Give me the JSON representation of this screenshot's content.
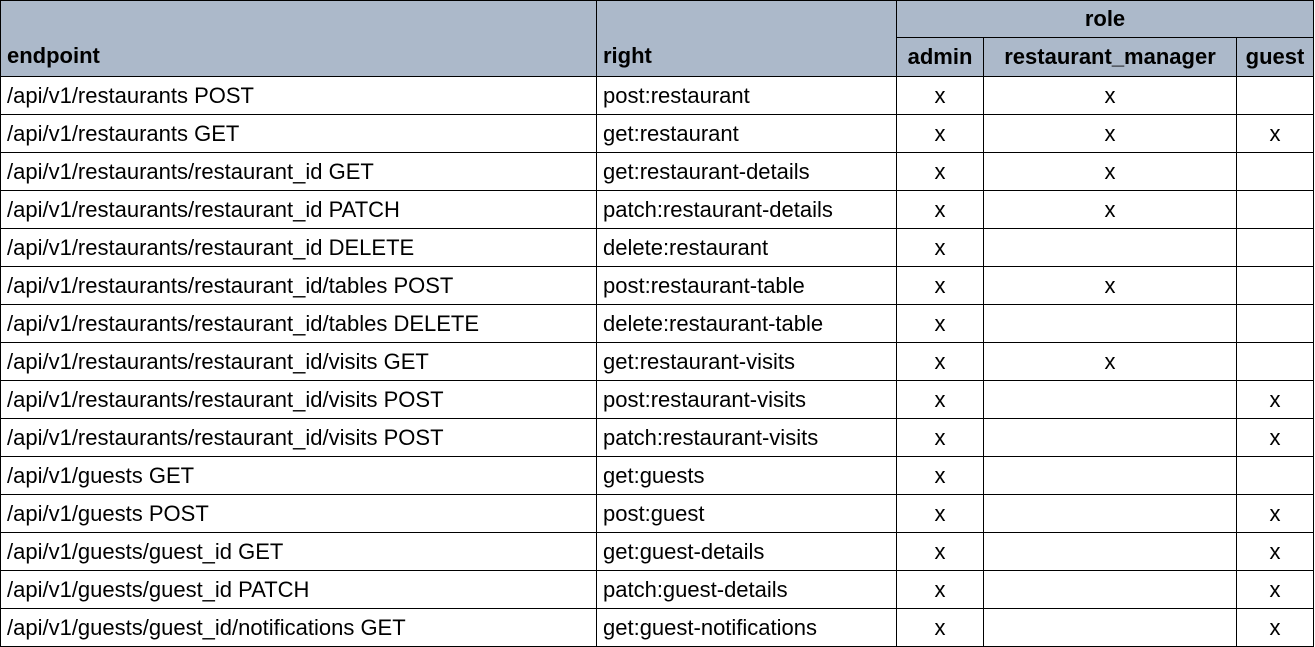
{
  "header": {
    "endpoint_label": "endpoint",
    "right_label": "right",
    "role_group_label": "role",
    "roles": [
      "admin",
      "restaurant_manager",
      "guest"
    ]
  },
  "mark_symbol": "x",
  "colors": {
    "header_bg": "#acb9ca",
    "grid": "#000000"
  },
  "rows": [
    {
      "endpoint": "/api/v1/restaurants POST",
      "right": "post:restaurant",
      "admin": "x",
      "restaurant_manager": "x",
      "guest": ""
    },
    {
      "endpoint": "/api/v1/restaurants GET",
      "right": "get:restaurant",
      "admin": "x",
      "restaurant_manager": "x",
      "guest": "x"
    },
    {
      "endpoint": "/api/v1/restaurants/restaurant_id GET",
      "right": "get:restaurant-details",
      "admin": "x",
      "restaurant_manager": "x",
      "guest": ""
    },
    {
      "endpoint": "/api/v1/restaurants/restaurant_id PATCH",
      "right": "patch:restaurant-details",
      "admin": "x",
      "restaurant_manager": "x",
      "guest": ""
    },
    {
      "endpoint": "/api/v1/restaurants/restaurant_id DELETE",
      "right": "delete:restaurant",
      "admin": "x",
      "restaurant_manager": "",
      "guest": ""
    },
    {
      "endpoint": "/api/v1/restaurants/restaurant_id/tables POST",
      "right": "post:restaurant-table",
      "admin": "x",
      "restaurant_manager": "x",
      "guest": ""
    },
    {
      "endpoint": "/api/v1/restaurants/restaurant_id/tables DELETE",
      "right": "delete:restaurant-table",
      "admin": "x",
      "restaurant_manager": "",
      "guest": ""
    },
    {
      "endpoint": "/api/v1/restaurants/restaurant_id/visits GET",
      "right": "get:restaurant-visits",
      "admin": "x",
      "restaurant_manager": "x",
      "guest": ""
    },
    {
      "endpoint": "/api/v1/restaurants/restaurant_id/visits POST",
      "right": "post:restaurant-visits",
      "admin": "x",
      "restaurant_manager": "",
      "guest": "x"
    },
    {
      "endpoint": "/api/v1/restaurants/restaurant_id/visits POST",
      "right": "patch:restaurant-visits",
      "admin": "x",
      "restaurant_manager": "",
      "guest": "x"
    },
    {
      "endpoint": "/api/v1/guests GET",
      "right": "get:guests",
      "admin": "x",
      "restaurant_manager": "",
      "guest": ""
    },
    {
      "endpoint": "/api/v1/guests POST",
      "right": "post:guest",
      "admin": "x",
      "restaurant_manager": "",
      "guest": "x"
    },
    {
      "endpoint": "/api/v1/guests/guest_id GET",
      "right": "get:guest-details",
      "admin": "x",
      "restaurant_manager": "",
      "guest": "x"
    },
    {
      "endpoint": "/api/v1/guests/guest_id PATCH",
      "right": "patch:guest-details",
      "admin": "x",
      "restaurant_manager": "",
      "guest": "x"
    },
    {
      "endpoint": "/api/v1/guests/guest_id/notifications GET",
      "right": "get:guest-notifications",
      "admin": "x",
      "restaurant_manager": "",
      "guest": "x"
    }
  ]
}
